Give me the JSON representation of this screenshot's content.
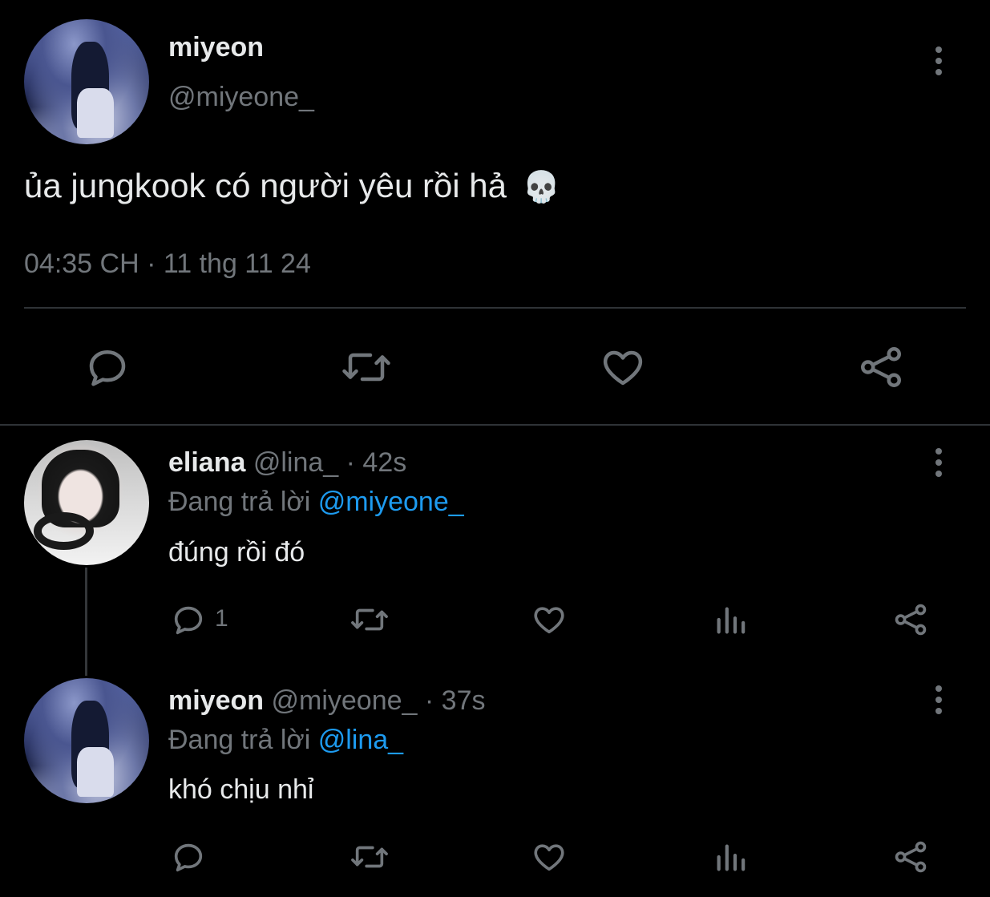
{
  "main_tweet": {
    "display_name": "miyeon",
    "handle": "@miyeone_",
    "text": "ủa jungkook có người yêu rồi hả",
    "emoji": "💀",
    "timestamp": "04:35 CH · 11 thg 11 24"
  },
  "replies": [
    {
      "display_name": "eliana",
      "handle": "@lina_",
      "time": "· 42s",
      "replying_prefix": "Đang trả lời",
      "replying_to": "@miyeone_",
      "text": "đúng rồi đó",
      "reply_count": "1"
    },
    {
      "display_name": "miyeon",
      "handle": "@miyeone_",
      "time": "· 37s",
      "replying_prefix": "Đang trả lời",
      "replying_to": "@lina_",
      "text": "khó chịu nhỉ",
      "reply_count": ""
    }
  ],
  "icons": {
    "more": "more-vertical-icon",
    "reply": "reply-icon",
    "retweet": "retweet-icon",
    "like": "heart-icon",
    "views": "views-icon",
    "share": "share-icon"
  },
  "colors": {
    "background": "#000000",
    "text": "#e7e9ea",
    "muted": "#71767b",
    "link": "#1d9bf0",
    "divider": "#2f3336"
  }
}
